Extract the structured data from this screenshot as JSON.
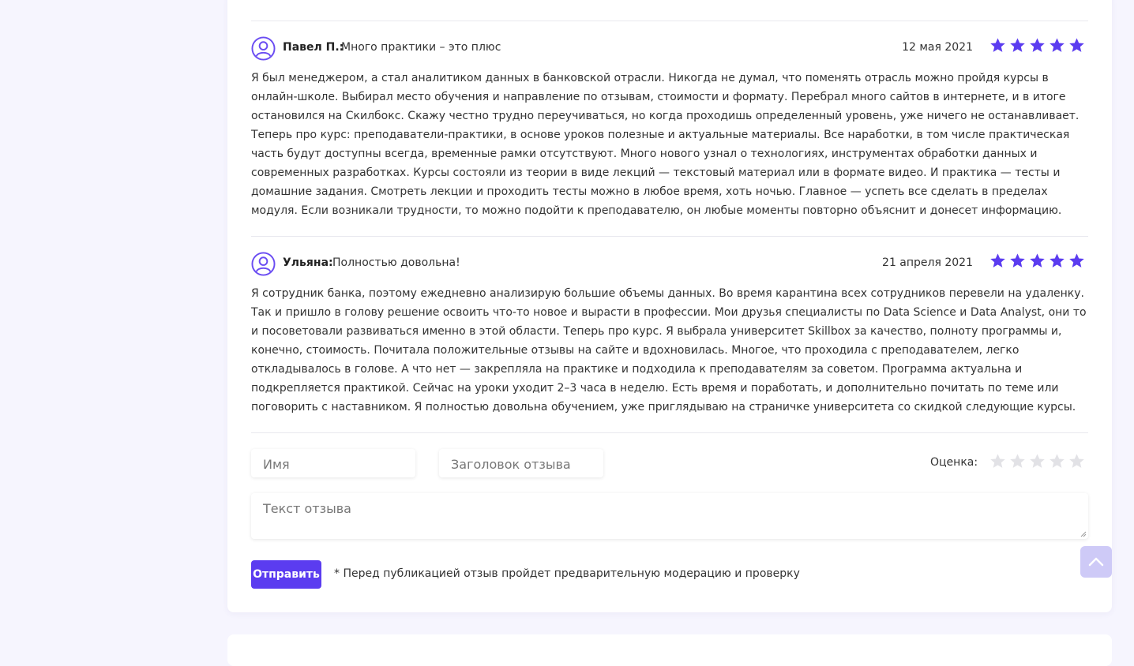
{
  "reviews": [
    {
      "author": "Павел П.:",
      "title": "Много практики – это плюс",
      "date": "12 мая 2021",
      "rating": 5,
      "text": "Я был менеджером, а стал аналитиком данных в банковской отрасли. Никогда не думал, что поменять отрасль можно пройдя курсы в онлайн-школе. Выбирал место обучения и направление по отзывам, стоимости и формату. Перебрал много сайтов в интернете, и в итоге остановился на Скилбокс. Скажу честно трудно переучиваться, но когда проходишь определенный уровень, уже ничего не останавливает. Теперь про курс: преподаватели-практики, в основе уроков полезные и актуальные материалы. Все наработки, в том числе практическая часть будут доступны всегда, временные рамки отсутствуют. Много нового узнал о технологиях, инструментах обработки данных и современных разработках. Курсы состояли из теории в виде лекций — текстовый материал или в формате видео. И практика — тесты и домашние задания. Смотреть лекции и проходить тесты можно в любое время, хоть ночью. Главное — успеть все сделать в пределах модуля. Если возникали трудности, то можно подойти к преподавателю, он любые моменты повторно объяснит и донесет информацию."
    },
    {
      "author": "Ульяна:",
      "title": "Полностью довольна!",
      "date": "21 апреля 2021",
      "rating": 5,
      "text": "Я сотрудник банка, поэтому ежедневно анализирую большие объемы данных. Во время карантина всех сотрудников перевели на удаленку. Так и пришло в голову решение освоить что-то новое и вырасти в профессии. Мои друзья специалисты по Data Science и Data Analyst, они то и посоветовали развиваться именно в этой области. Теперь про курс. Я выбрала университет Skillbox за качество, полноту программы и, конечно, стоимость. Почитала положительные отзывы на сайте и вдохновилась. Многое, что проходила с преподавателем, легко откладывалось в голове. А что нет — закрепляла на практике и подходила к преподавателям за советом. Программа актуальна и подкрепляется практикой. Сейчас на уроки уходит 2–3 часа в неделю. Есть время и поработать, и дополнительно почитать по теме или поговорить с наставником. Я полностью довольна обучением, уже приглядываю на страничке университета со скидкой следующие курсы."
    }
  ],
  "form": {
    "name_placeholder": "Имя",
    "title_placeholder": "Заголовок отзыва",
    "rating_label": "Оценка:",
    "rating_value": 0,
    "text_placeholder": "Текст отзыва",
    "submit_label": "Отправить",
    "moderation_note": "* Перед публикацией отзыв пройдет предварительную модерацию и проверку"
  },
  "colors": {
    "accent": "#5b3cf0",
    "star_filled": "#5b3cf0",
    "star_empty": "#e2e2e6",
    "avatar": "#6a4cf2"
  },
  "icons": {
    "avatar": "user-circle-icon",
    "star": "star-icon",
    "scroll_top": "chevron-up-icon"
  }
}
